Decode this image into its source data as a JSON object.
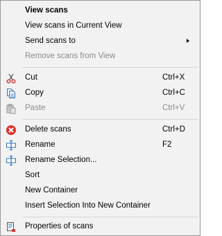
{
  "menu": {
    "items": [
      {
        "label": "View scans",
        "shortcut": "",
        "icon": "",
        "bold": true,
        "disabled": false,
        "submenu": false
      },
      {
        "label": "View scans in Current View",
        "shortcut": "",
        "icon": "",
        "bold": false,
        "disabled": false,
        "submenu": false
      },
      {
        "label": "Send scans to",
        "shortcut": "",
        "icon": "",
        "bold": false,
        "disabled": false,
        "submenu": true
      },
      {
        "label": "Remove scans from View",
        "shortcut": "",
        "icon": "",
        "bold": false,
        "disabled": true,
        "submenu": false
      },
      {
        "label": "Cut",
        "shortcut": "Ctrl+X",
        "icon": "scissors-icon",
        "bold": false,
        "disabled": false,
        "submenu": false
      },
      {
        "label": "Copy",
        "shortcut": "Ctrl+C",
        "icon": "copy-icon",
        "bold": false,
        "disabled": false,
        "submenu": false
      },
      {
        "label": "Paste",
        "shortcut": "Ctrl+V",
        "icon": "paste-icon",
        "bold": false,
        "disabled": true,
        "submenu": false
      },
      {
        "label": "Delete scans",
        "shortcut": "Ctrl+D",
        "icon": "delete-icon",
        "bold": false,
        "disabled": false,
        "submenu": false
      },
      {
        "label": "Rename",
        "shortcut": "F2",
        "icon": "rename-icon",
        "bold": false,
        "disabled": false,
        "submenu": false
      },
      {
        "label": "Rename Selection...",
        "shortcut": "",
        "icon": "rename-selection-icon",
        "bold": false,
        "disabled": false,
        "submenu": false
      },
      {
        "label": "Sort",
        "shortcut": "",
        "icon": "",
        "bold": false,
        "disabled": false,
        "submenu": false
      },
      {
        "label": "New Container",
        "shortcut": "",
        "icon": "",
        "bold": false,
        "disabled": false,
        "submenu": false
      },
      {
        "label": "Insert Selection Into New Container",
        "shortcut": "",
        "icon": "",
        "bold": false,
        "disabled": false,
        "submenu": false
      },
      {
        "label": "Properties of scans",
        "shortcut": "",
        "icon": "properties-icon",
        "bold": false,
        "disabled": false,
        "submenu": false
      }
    ]
  },
  "colors": {
    "menu_background": "#f2f2f2",
    "menu_border": "#979797",
    "separator": "#d7d7d7",
    "disabled_text": "#8b8b8b",
    "delete_icon": "#d9342b",
    "icon_blue": "#2f6fb3",
    "cut_red": "#d03b3b"
  }
}
